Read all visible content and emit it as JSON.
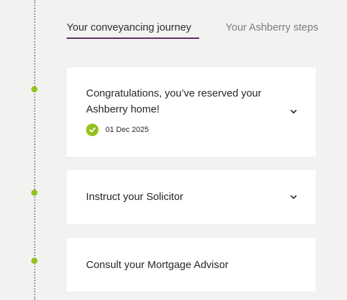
{
  "tabs": [
    {
      "label": "Your conveyancing journey",
      "active": true
    },
    {
      "label": "Your Ashberry steps",
      "active": false
    }
  ],
  "steps": [
    {
      "title_line1": "Congratulations, you’ve reserved your",
      "title_line2": "Ashberry home!",
      "completed": true,
      "date": "01 Dec 2025",
      "expandable": true
    },
    {
      "title": "Instruct your Solicitor",
      "completed": false,
      "expandable": true
    },
    {
      "title": "Consult your Mortgage Advisor",
      "completed": false,
      "expandable": false
    }
  ],
  "colors": {
    "accent": "#97c11f",
    "tab_underline": "#5c2a63",
    "background": "#f2f2f1"
  },
  "icons": {
    "check": "check-icon",
    "expand": "chevron-down-icon"
  }
}
